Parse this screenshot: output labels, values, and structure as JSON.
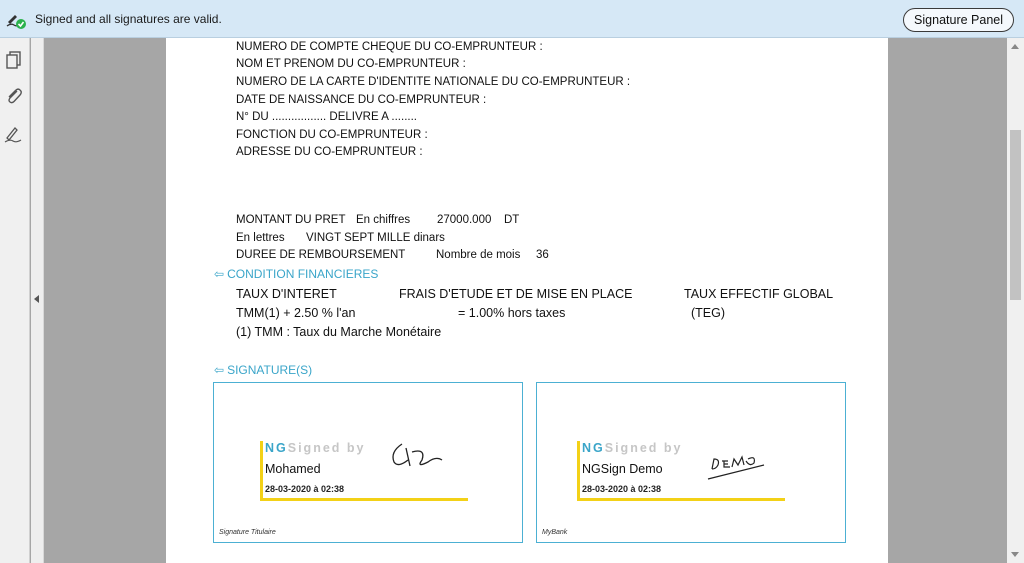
{
  "signature_bar": {
    "message": "Signed and all signatures are valid.",
    "panel_button": "Signature Panel"
  },
  "document": {
    "coborrower_fields": [
      "NUMERO DE COMPTE CHEQUE DU CO-EMPRUNTEUR :",
      "NOM ET PRENOM DU CO-EMPRUNTEUR :",
      "NUMERO DE LA CARTE D'IDENTITE NATIONALE DU CO-EMPRUNTEUR :",
      "DATE DE NAISSANCE DU CO-EMPRUNTEUR :",
      "N°   DU ................. DELIVRE A ........",
      "FONCTION DU CO-EMPRUNTEUR  :",
      "ADRESSE DU CO-EMPRUNTEUR :"
    ],
    "loan": {
      "amount_label": "MONTANT DU PRET",
      "in_figures_label": "En  chiffres",
      "amount_value": "27000.000",
      "currency": "DT",
      "in_words_label": "En lettres",
      "amount_words": "VINGT SEPT MILLE  dinars",
      "duration_label": "DUREE DE REMBOURSEMENT",
      "months_label": "Nombre de mois",
      "months_value": "36"
    },
    "financial_section": {
      "arrow": "⇦",
      "title": "CONDITION FINANCIERES",
      "headers": [
        "TAUX D'INTERET",
        "FRAIS D'ETUDE ET DE MISE EN PLACE",
        "TAUX EFFECTIF GLOBAL"
      ],
      "values": [
        "TMM(1) +  2.50 % l'an",
        "= 1.00% hors taxes",
        "(TEG)"
      ],
      "footnote": "(1) TMM : Taux du Marche Monétaire"
    },
    "signatures_section": {
      "arrow": "⇦",
      "title": "SIGNATURE(S)",
      "boxes": [
        {
          "brand_prefix": "NG",
          "brand_suffix": "Signed by",
          "name": "Mohamed",
          "date": "28-03-2020 à 02:38",
          "caption": "Signature Titulaire"
        },
        {
          "brand_prefix": "NG",
          "brand_suffix": "Signed by",
          "name": "NGSign Demo",
          "date": "28-03-2020 à 02:38",
          "caption": "MyBank"
        }
      ]
    }
  },
  "colors": {
    "accent": "#3aa5c9",
    "signature_bar_bg": "#d6e8f6",
    "stamp_yellow": "#f3d117",
    "valid_green": "#2bb24c"
  },
  "icons": {
    "signature_status": "pen-check-icon",
    "left_rail": [
      "pages-icon",
      "paperclip-icon",
      "signature-pen-icon"
    ]
  }
}
